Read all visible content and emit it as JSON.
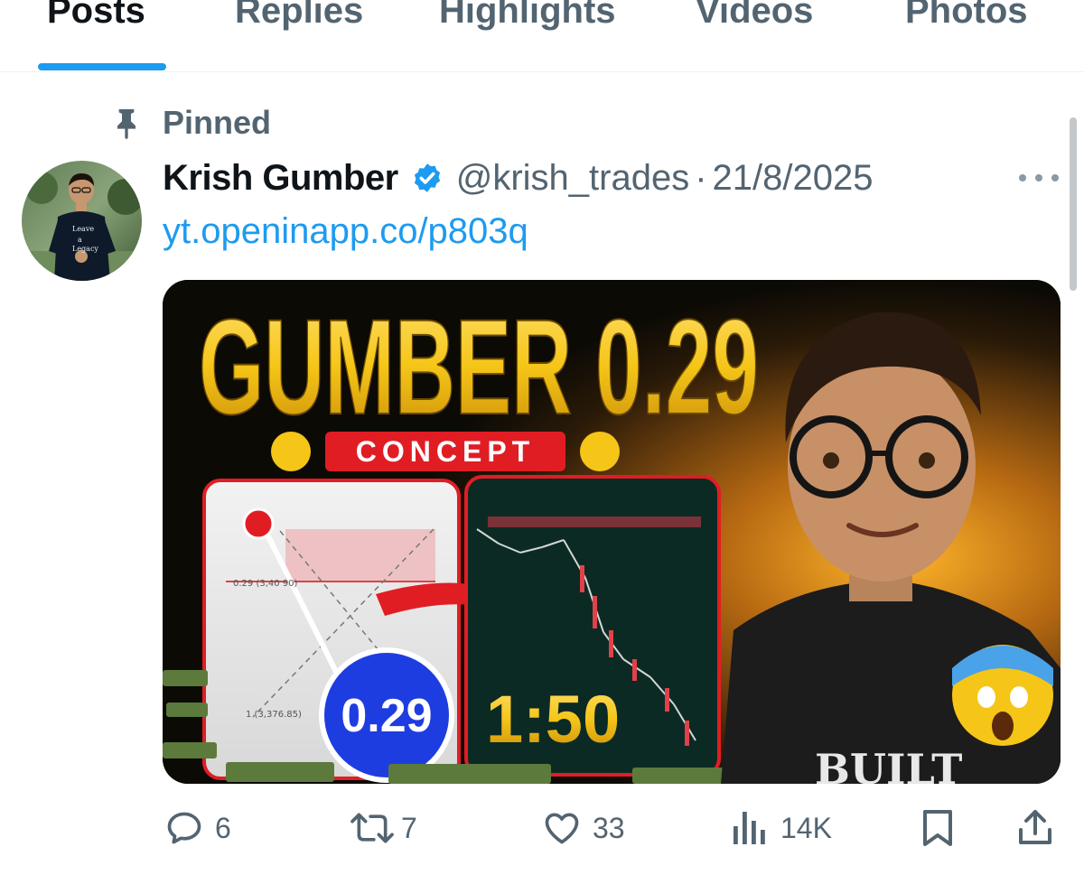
{
  "tabs": [
    {
      "label": "Posts",
      "active": true
    },
    {
      "label": "Replies",
      "active": false
    },
    {
      "label": "Highlights",
      "active": false
    },
    {
      "label": "Videos",
      "active": false
    },
    {
      "label": "Photos",
      "active": false
    }
  ],
  "pinned": {
    "label": "Pinned",
    "icon": "pin-icon"
  },
  "post": {
    "author_name": "Krish Gumber",
    "verified": true,
    "handle": "@krish_trades",
    "separator": "·",
    "date": "21/8/2025",
    "link_text": "yt.openinapp.co/p803q",
    "media": {
      "title_line": "GUMBER 0.29",
      "subtitle": "CONCEPT",
      "chart_label_1": "0.29 (3,40 90)",
      "chart_label_2": "1 (3,376.85)",
      "badge_value": "0.29",
      "ratio": "1:50",
      "shirt_text": "BUILT"
    },
    "actions": {
      "replies": "6",
      "reposts": "7",
      "likes": "33",
      "views": "14K"
    }
  },
  "colors": {
    "accent": "#1d9bf0",
    "text_primary": "#0f1419",
    "text_secondary": "#536471",
    "thumb_yellow": "#f5c518",
    "thumb_red": "#e11d24",
    "thumb_blue": "#1e3de0"
  }
}
